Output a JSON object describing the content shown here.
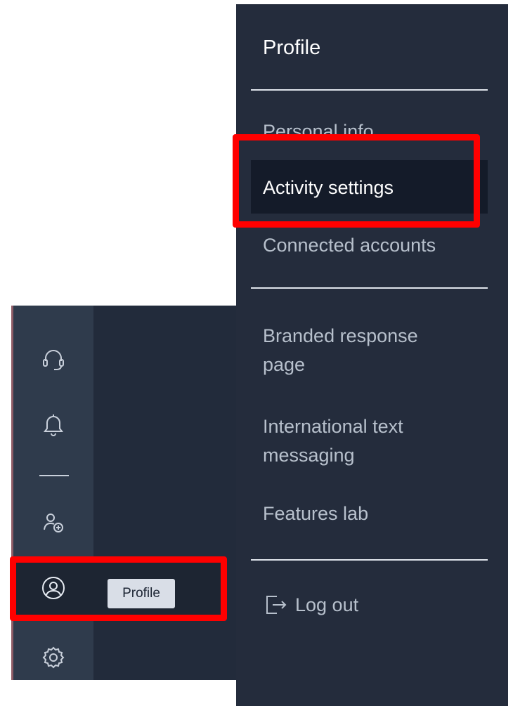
{
  "panel": {
    "title": "Profile",
    "section1": [
      {
        "label": "Personal info"
      },
      {
        "label": "Activity settings"
      },
      {
        "label": "Connected accounts"
      }
    ],
    "section2": [
      {
        "label": "Branded response page"
      },
      {
        "label": "International text messaging"
      },
      {
        "label": "Features lab"
      }
    ],
    "logout_label": "Log out"
  },
  "rail": {
    "items": [
      {
        "icon": "headset-icon"
      },
      {
        "icon": "bell-icon"
      },
      {
        "icon": "add-user-icon"
      },
      {
        "icon": "user-circle-icon"
      },
      {
        "icon": "gear-icon"
      }
    ],
    "tooltip": "Profile"
  },
  "colors": {
    "panel_bg": "#242c3c",
    "rail_bg": "#2f3b4c",
    "active_bg": "#141b29",
    "highlight": "#ff0000"
  }
}
